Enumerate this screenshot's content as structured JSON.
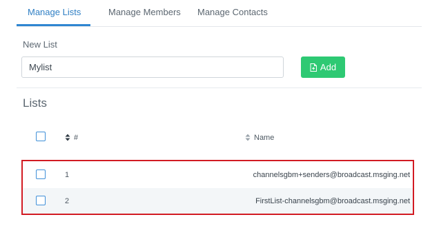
{
  "tabs": [
    {
      "label": "Manage Lists",
      "active": true
    },
    {
      "label": "Manage Members",
      "active": false
    },
    {
      "label": "Manage Contacts",
      "active": false
    }
  ],
  "new_list": {
    "label": "New List",
    "input_value": "Mylist",
    "add_label": "Add"
  },
  "lists": {
    "title": "Lists",
    "columns": {
      "id": "#",
      "name": "Name"
    },
    "rows": [
      {
        "id": "1",
        "name": "channelsgbm+senders@broadcast.msging.net"
      },
      {
        "id": "2",
        "name": "FirstList-channelsgbm@broadcast.msging.net"
      }
    ]
  },
  "colors": {
    "accent": "#2f86d1",
    "add_button": "#2ec973",
    "highlight": "#d21a22",
    "row_alt_background": "#f3f6f8"
  },
  "icons": {
    "add": "document-add-icon",
    "sort": "sort-icon",
    "checkbox": "checkbox-icon"
  }
}
